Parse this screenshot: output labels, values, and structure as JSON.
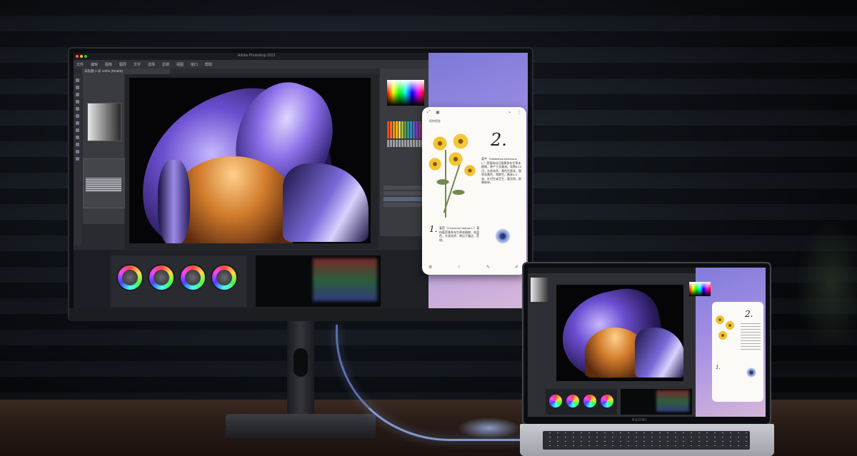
{
  "monitor": {
    "app_window_title": "Adobe Photoshop 2023",
    "menu_items": [
      "文件",
      "编辑",
      "图像",
      "图层",
      "文字",
      "选择",
      "滤镜",
      "视图",
      "窗口",
      "帮助"
    ],
    "document_tab": "未标题-1 @ 100% (RGB/8)"
  },
  "reader": {
    "header_label": "植物图鉴",
    "big_number": "2.",
    "paragraph_2": "菊芋（Helianthus tuberosus L.）是菊科向日葵属多年生草本植物，原产于北美洲。花期8-10月，头状花序，黄色舌状花，管状花黄色，常群生，株高1-3米，叶对生或互生，喜光照，耐寒耐旱。",
    "mid_number": "1.",
    "paragraph_1": "菊苣（Cichorium intybus L.）菊科菊苣属多年生草本植物，花蓝色，头状花序，常见于路边、荒地。"
  },
  "laptop": {
    "brand": "REDMI",
    "reader_big_number": "2.",
    "reader_mid_number": "1."
  },
  "colors": {
    "accent_purple": "#8c7fcf",
    "glow_blue": "#a0beff",
    "flower_yellow": "#f2c230"
  }
}
